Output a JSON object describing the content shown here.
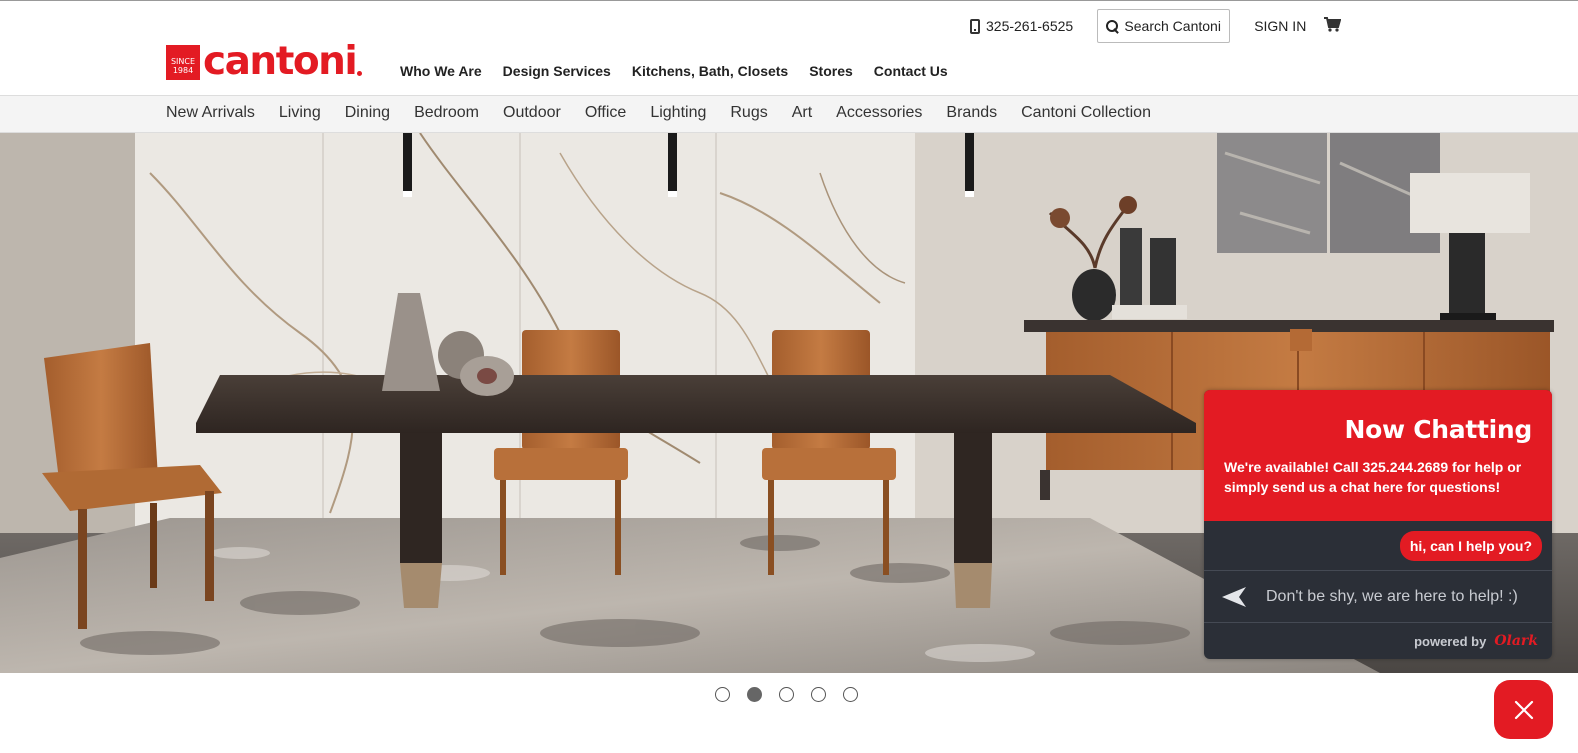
{
  "brand": {
    "since": "SINCE",
    "year": "1984",
    "name": "cantoni",
    "red": "#e31b23"
  },
  "utility": {
    "phone": "325-261-6525",
    "search_label": "Search Cantoni",
    "signin": "SIGN IN",
    "cart_icon": "cart-icon"
  },
  "main_nav": [
    "Who We Are",
    "Design Services",
    "Kitchens, Bath, Closets",
    "Stores",
    "Contact Us"
  ],
  "category_nav": [
    "New Arrivals",
    "Living",
    "Dining",
    "Bedroom",
    "Outdoor",
    "Office",
    "Lighting",
    "Rugs",
    "Art",
    "Accessories",
    "Brands",
    "Cantoni Collection"
  ],
  "carousel": {
    "slides": 5,
    "active_index": 1
  },
  "chat": {
    "title": "Now Chatting",
    "message": "We're available! Call 325.244.2689 for help or simply send us a chat here for questions!",
    "bubble": "hi, can I help you?",
    "placeholder": "Don't be shy, we are here to help! :)",
    "powered_by": "powered by",
    "powered_brand": "Olark"
  }
}
